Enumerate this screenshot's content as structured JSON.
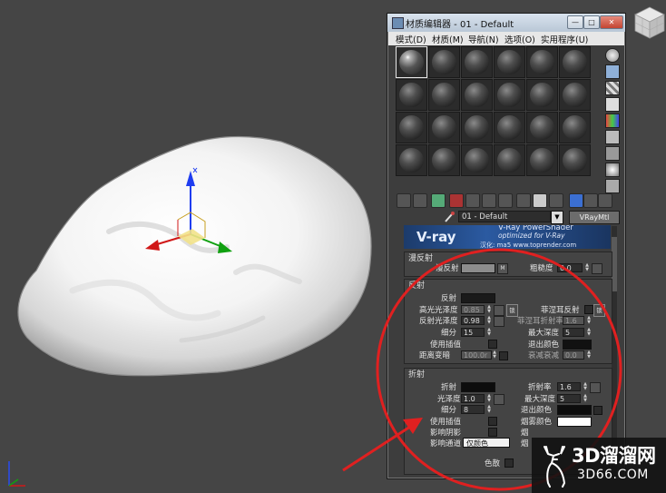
{
  "material_editor": {
    "title": "材质编辑器 - 01 - Default",
    "window_buttons": {
      "minimize": "—",
      "maximize": "□",
      "close": "✕"
    },
    "menu": [
      "模式(D)",
      "材质(M)",
      "导航(N)",
      "选项(O)",
      "实用程序(U)"
    ],
    "slots": {
      "rows": 4,
      "columns": 6,
      "active_index": 0
    },
    "material_name": "01 - Default",
    "material_type": "VRayMtl",
    "banner": {
      "logo": "V-ray",
      "line1": "V-Ray PowerShader",
      "line2": "optimized for V-Ray",
      "line3": "汉化: ma5  www.toprender.com"
    },
    "diffuse_section": {
      "title": "漫反射",
      "diffuse_label": "漫反射",
      "map_button": "M",
      "roughness_label": "粗糙度",
      "roughness_value": "0.0"
    },
    "reflection_section": {
      "title": "反射",
      "reflect_label": "反射",
      "hilight_gloss_label": "高光光泽度",
      "hilight_gloss_value": "0.85",
      "refl_gloss_label": "反射光泽度",
      "refl_gloss_value": "0.98",
      "subdivs_label": "细分",
      "subdivs_value": "15",
      "use_interp_label": "使用插值",
      "dim_distance_label": "距离变暗",
      "dim_distance_value": "100.0r",
      "lock_label": "锁",
      "fresnel_label": "菲涅耳反射",
      "fresnel_ior_label": "菲涅耳折射率",
      "fresnel_ior_value": "1.6",
      "max_depth_label": "最大深度",
      "max_depth_value": "5",
      "exit_color_label": "退出颜色",
      "dim_falloff_label": "衰减衰减",
      "dim_falloff_value": "0.0"
    },
    "refraction_section": {
      "title": "折射",
      "refract_label": "折射",
      "glossiness_label": "光泽度",
      "glossiness_value": "1.0",
      "subdivs_label": "细分",
      "subdivs_value": "8",
      "use_interp_label": "使用插值",
      "affect_shadows_label": "影响阴影",
      "affect_channels_label": "影响通道",
      "affect_channels_value": "仅颜色",
      "dispersion_label": "色散",
      "ior_label": "折射率",
      "ior_value": "1.6",
      "max_depth_label": "最大深度",
      "max_depth_value": "5",
      "exit_color_label": "退出颜色",
      "fog_color_label": "烟雾颜色",
      "fog_mult_label": "烟",
      "fog_bias_label": "烟"
    }
  },
  "watermark": {
    "brand": "3D溜溜网",
    "url": "3D66.COM"
  },
  "colors": {
    "viewport_bg": "#454545",
    "annotation_red": "#e02020",
    "gizmo_blue": "#1f3df0",
    "gizmo_red": "#d01818",
    "gizmo_green": "#10a010"
  }
}
